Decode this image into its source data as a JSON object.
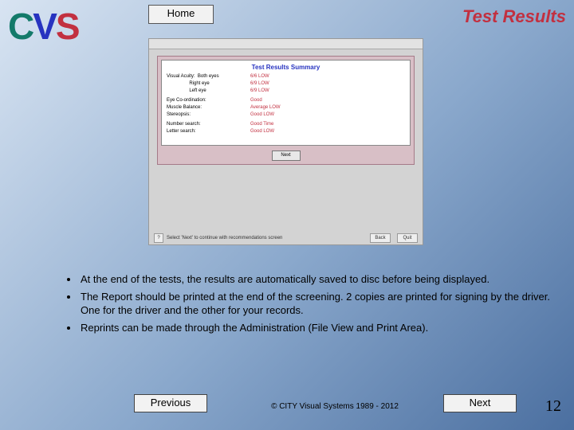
{
  "logo": {
    "c": "C",
    "v": "V",
    "s": "S"
  },
  "nav": {
    "home": "Home",
    "prev": "Previous",
    "next": "Next"
  },
  "title": "Test Results",
  "shot": {
    "heading": "Test Results Summary",
    "next_btn": "Next",
    "hint": "Select 'Next' to continue with recommendations screen",
    "foot_left": "Back",
    "foot_right": "Quit",
    "rows": [
      {
        "l": "Visual Acuity:  Both eyes\n                 Right eye\n                 Left eye",
        "r": "6/6 LOW\n6/9 LOW\n6/9 LOW"
      },
      {
        "l": "Eye Co-ordination:",
        "r": "Good"
      },
      {
        "l": "Muscle Balance:",
        "r": "Average LOW"
      },
      {
        "l": "Stereopsis:",
        "r": "Good LOW"
      },
      {
        "l": "Number search:",
        "r": "Good Time"
      },
      {
        "l": "Letter search:",
        "r": "Good LOW"
      }
    ]
  },
  "bullets": [
    "At the end of the tests, the results are automatically saved to disc before being displayed.",
    "The Report should be printed at the end of the screening. 2 copies are printed for signing by the driver. One for the driver and the other for your records.",
    "Reprints can be made through the Administration (File View and Print Area)."
  ],
  "footer": {
    "copyright": "© CITY Visual Systems 1989 - 2012",
    "page": "12"
  }
}
